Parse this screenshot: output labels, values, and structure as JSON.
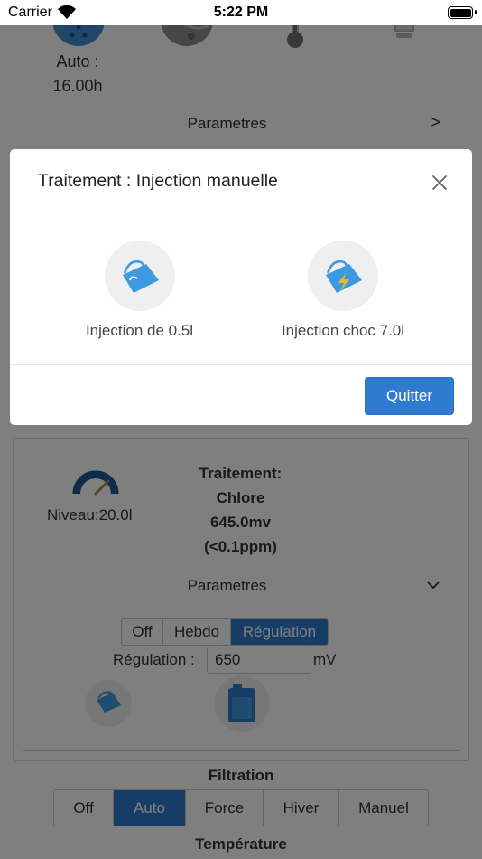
{
  "status_bar": {
    "carrier": "Carrier",
    "time": "5:22 PM"
  },
  "top_section": {
    "mode_line1": "Auto :",
    "mode_line2": "16.00h",
    "params_label": "Parametres",
    "params_chevron": ">"
  },
  "modal": {
    "title": "Traitement : Injection manuelle",
    "options": [
      {
        "label": "Injection de 0.5l",
        "icon": "bucket-pour-icon"
      },
      {
        "label": "Injection choc 7.0l",
        "icon": "bucket-shock-icon"
      }
    ],
    "quit_label": "Quitter"
  },
  "treatment_card": {
    "level_label": "Niveau:20.0l",
    "level_fraction": 0.2,
    "title_line1": "Traitement:",
    "title_line2": "Chlore",
    "value_line1": "645.0mv",
    "value_line2": "(<0.1ppm)",
    "params_label": "Parametres",
    "params_chevron": "v",
    "mode_tabs": [
      "Off",
      "Hebdo",
      "Régulation"
    ],
    "mode_selected": "Régulation",
    "regulation_label": "Régulation :",
    "regulation_value": "650",
    "regulation_unit": "mV"
  },
  "filtration": {
    "title": "Filtration",
    "tabs": [
      "Off",
      "Auto",
      "Force",
      "Hiver",
      "Manuel"
    ],
    "selected": "Auto"
  },
  "temperature": {
    "title": "Température"
  },
  "colors": {
    "accent": "#2e7bcf",
    "icon_blue": "#3d9ae0",
    "backdrop": "rgba(0,0,0,0.5)"
  }
}
